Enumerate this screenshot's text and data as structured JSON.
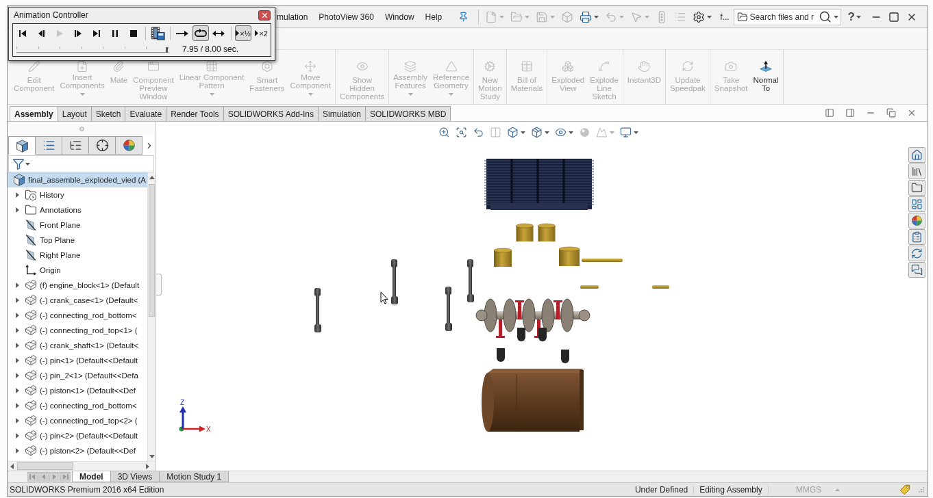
{
  "animation_controller": {
    "title": "Animation Controller",
    "transport": [
      {
        "kind": "start",
        "disabled": false
      },
      {
        "kind": "step_back",
        "disabled": false
      },
      {
        "kind": "play",
        "disabled": true
      },
      {
        "kind": "step_forward",
        "disabled": false
      },
      {
        "kind": "end",
        "disabled": false
      },
      {
        "kind": "pause",
        "disabled": false
      },
      {
        "kind": "stop",
        "disabled": false
      }
    ],
    "modes": [
      {
        "kind": "normal",
        "selected": false
      },
      {
        "kind": "loop",
        "selected": true
      },
      {
        "kind": "reciprocate",
        "selected": false
      }
    ],
    "speeds": [
      {
        "label": "×½",
        "selected": true
      },
      {
        "label": "×2",
        "selected": false
      }
    ],
    "timeline": {
      "level": 0.99
    },
    "time": "7.95 / 8.00 sec."
  },
  "menu": [
    "mulation",
    "PhotoView 360",
    "Window",
    "Help"
  ],
  "quick_access": [
    {
      "kind": "new",
      "disabled": true,
      "menu": true
    },
    {
      "kind": "open",
      "disabled": true,
      "menu": true
    },
    {
      "kind": "save",
      "disabled": true,
      "menu": true
    },
    {
      "kind": "rebuild",
      "disabled": true,
      "menu": false
    },
    {
      "kind": "print",
      "disabled": false,
      "menu": true
    },
    {
      "kind": "undo",
      "disabled": true,
      "menu": true
    },
    {
      "kind": "select",
      "disabled": true,
      "menu": true
    },
    {
      "kind": "traffic",
      "disabled": true,
      "menu": false
    },
    {
      "kind": "properties",
      "disabled": true,
      "menu": false
    },
    {
      "kind": "options",
      "disabled": false,
      "menu": true
    }
  ],
  "file_name": "f...",
  "search": {
    "placeholder": "Search files and r"
  },
  "help": "?",
  "ribbon": [
    {
      "buttons": [
        {
          "kind": "edit",
          "label": "Edit\nComponent",
          "disabled": true,
          "menu": false
        },
        {
          "kind": "insert",
          "label": "Insert\nComponents",
          "disabled": true,
          "menu": true
        },
        {
          "kind": "mate",
          "label": "Mate",
          "disabled": true,
          "menu": false
        },
        {
          "kind": "preview",
          "label": "Component\nPreview\nWindow",
          "disabled": true,
          "menu": false
        },
        {
          "kind": "pattern",
          "label": "Linear Component\nPattern",
          "disabled": true,
          "menu": true
        },
        {
          "kind": "fasteners",
          "label": "Smart\nFasteners",
          "disabled": true,
          "menu": false
        },
        {
          "kind": "move",
          "label": "Move\nComponent",
          "disabled": true,
          "menu": true
        }
      ]
    },
    {
      "buttons": [
        {
          "kind": "show_hidden",
          "label": "Show\nHidden\nComponents",
          "disabled": true,
          "menu": false
        }
      ]
    },
    {
      "buttons": [
        {
          "kind": "features",
          "label": "Assembly\nFeatures",
          "disabled": true,
          "menu": true
        },
        {
          "kind": "reference",
          "label": "Reference\nGeometry",
          "disabled": true,
          "menu": true
        }
      ]
    },
    {
      "buttons": [
        {
          "kind": "motion",
          "label": "New\nMotion\nStudy",
          "disabled": true,
          "menu": false
        }
      ]
    },
    {
      "buttons": [
        {
          "kind": "bom",
          "label": "Bill of\nMaterials",
          "disabled": true,
          "menu": false
        }
      ]
    },
    {
      "buttons": [
        {
          "kind": "exploded",
          "label": "Exploded\nView",
          "disabled": true,
          "menu": false
        },
        {
          "kind": "explode_line",
          "label": "Explode\nLine\nSketch",
          "disabled": true,
          "menu": false
        }
      ]
    },
    {
      "buttons": [
        {
          "kind": "instant3d",
          "label": "Instant3D",
          "disabled": true,
          "menu": false
        }
      ]
    },
    {
      "buttons": [
        {
          "kind": "speedpak",
          "label": "Update\nSpeedpak",
          "disabled": true,
          "menu": false
        }
      ]
    },
    {
      "buttons": [
        {
          "kind": "snapshot",
          "label": "Take\nSnapshot",
          "disabled": true,
          "menu": false
        },
        {
          "kind": "normal_to",
          "label": "Normal\nTo",
          "disabled": false,
          "menu": false
        }
      ]
    }
  ],
  "command_tabs": [
    {
      "label": "Assembly",
      "selected": true
    },
    {
      "label": "Layout",
      "selected": false
    },
    {
      "label": "Sketch",
      "selected": false
    },
    {
      "label": "Evaluate",
      "selected": false
    },
    {
      "label": "Render Tools",
      "selected": false
    },
    {
      "label": "SOLIDWORKS Add-Ins",
      "selected": false
    },
    {
      "label": "Simulation",
      "selected": false
    },
    {
      "label": "SOLIDWORKS MBD",
      "selected": false
    }
  ],
  "feature_manager": {
    "tabs": [
      {
        "kind": "feature_tree",
        "selected": true
      },
      {
        "kind": "property",
        "selected": false
      },
      {
        "kind": "configuration",
        "selected": false
      },
      {
        "kind": "dimxpert",
        "selected": false
      },
      {
        "kind": "display",
        "selected": false
      }
    ],
    "tree": [
      {
        "label": "final_assemble_exploded_vied (A",
        "kind": "assembly",
        "selected": true,
        "expandable": false,
        "children": [
          {
            "label": "History",
            "kind": "history",
            "selected": false,
            "expandable": true
          },
          {
            "label": "Annotations",
            "kind": "annotations",
            "selected": false,
            "expandable": true
          },
          {
            "label": "Front Plane",
            "kind": "plane",
            "selected": false,
            "expandable": false
          },
          {
            "label": "Top Plane",
            "kind": "plane",
            "selected": false,
            "expandable": false
          },
          {
            "label": "Right Plane",
            "kind": "plane",
            "selected": false,
            "expandable": false
          },
          {
            "label": "Origin",
            "kind": "origin",
            "selected": false,
            "expandable": false
          },
          {
            "label": "(f) engine_block<1> (Default",
            "kind": "part",
            "selected": false,
            "expandable": true
          },
          {
            "label": "(-) crank_case<1> (Default<",
            "kind": "part",
            "selected": false,
            "expandable": true
          },
          {
            "label": "(-) connecting_rod_bottom<",
            "kind": "part",
            "selected": false,
            "expandable": true
          },
          {
            "label": "(-) connecting_rod_top<1> (",
            "kind": "part",
            "selected": false,
            "expandable": true
          },
          {
            "label": "(-) crank_shaft<1> (Default<",
            "kind": "part",
            "selected": false,
            "expandable": true
          },
          {
            "label": "(-) pin<1> (Default<<Default",
            "kind": "part",
            "selected": false,
            "expandable": true
          },
          {
            "label": "(-) pin_2<1> (Default<<Defa",
            "kind": "part",
            "selected": false,
            "expandable": true
          },
          {
            "label": "(-) piston<1> (Default<<Def",
            "kind": "part",
            "selected": false,
            "expandable": true
          },
          {
            "label": "(-) connecting_rod_bottom<",
            "kind": "part",
            "selected": false,
            "expandable": true
          },
          {
            "label": "(-) connecting_rod_top<2> (",
            "kind": "part",
            "selected": false,
            "expandable": true
          },
          {
            "label": "(-) pin<2> (Default<<Default",
            "kind": "part",
            "selected": false,
            "expandable": true
          },
          {
            "label": "(-) piston<2> (Default<<Def",
            "kind": "part",
            "selected": false,
            "expandable": true
          }
        ]
      }
    ]
  },
  "view_toolbar": [
    {
      "kind": "zoom_fit",
      "disabled": false,
      "menu": false
    },
    {
      "kind": "zoom_area",
      "disabled": false,
      "menu": false
    },
    {
      "kind": "previous_view",
      "disabled": false,
      "menu": false
    },
    {
      "kind": "section",
      "disabled": true,
      "menu": false
    },
    {
      "kind": "orientation",
      "disabled": false,
      "menu": true
    },
    {
      "kind": "display_style",
      "disabled": false,
      "menu": true
    },
    {
      "kind": "hide_show",
      "disabled": false,
      "menu": true
    },
    {
      "kind": "appearance",
      "disabled": true,
      "menu": false
    },
    {
      "kind": "scene",
      "disabled": true,
      "menu": true
    },
    {
      "kind": "view_settings",
      "disabled": false,
      "menu": true
    }
  ],
  "triad_labels": [
    "Z",
    "X"
  ],
  "bottom_tabs": [
    {
      "label": "Model",
      "selected": true
    },
    {
      "label": "3D Views",
      "selected": false
    },
    {
      "label": "Motion Study 1",
      "selected": false
    }
  ],
  "status_bar": {
    "edition": "SOLIDWORKS Premium 2016 x64 Edition",
    "fields": [
      "Under Defined",
      "Editing Assembly"
    ],
    "units": {
      "label": "MMGS",
      "disabled": true
    }
  }
}
